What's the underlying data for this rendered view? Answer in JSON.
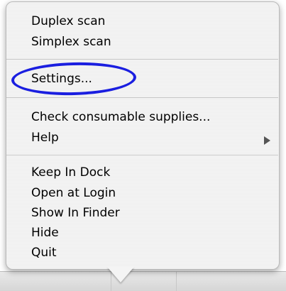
{
  "menu": {
    "group1": [
      {
        "label": "Duplex scan"
      },
      {
        "label": "Simplex scan"
      }
    ],
    "group2": [
      {
        "label": "Settings..."
      }
    ],
    "group3": [
      {
        "label": "Check consumable supplies..."
      },
      {
        "label": "Help",
        "has_submenu": true
      }
    ],
    "group4": [
      {
        "label": "Keep In Dock"
      },
      {
        "label": "Open at Login"
      },
      {
        "label": "Show In Finder"
      },
      {
        "label": "Hide"
      },
      {
        "label": "Quit"
      }
    ]
  },
  "annotation": {
    "shape": "ellipse",
    "color": "#1a1ee0",
    "highlights": "Settings..."
  },
  "icons": {
    "submenu": "submenu-arrow-icon"
  }
}
